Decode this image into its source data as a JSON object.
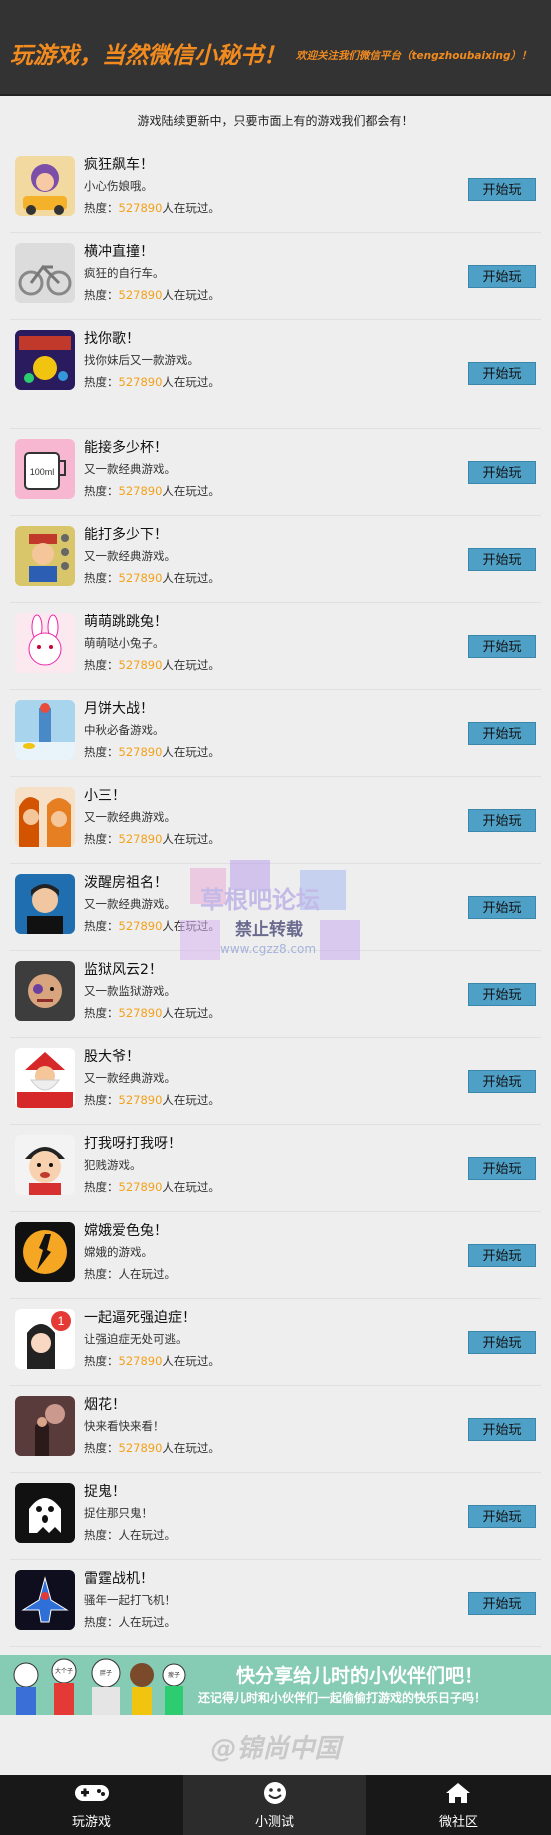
{
  "header": {
    "title": "玩游戏，当然微信小秘书！",
    "subtitle": "欢迎关注我们微信平台（tengzhoubaixing）！"
  },
  "notice": "游戏陆续更新中，只要市面上有的游戏我们都会有！",
  "games": [
    {
      "name": "疯狂飙车！",
      "desc": "小心伤娘哦。",
      "heat_prefix": "热度：",
      "heat": "527890",
      "heat_suffix": "人在玩过。",
      "button": "开始玩",
      "icon": "racing-car-icon"
    },
    {
      "name": "横冲直撞！",
      "desc": "疯狂的自行车。",
      "heat_prefix": "热度：",
      "heat": "527890",
      "heat_suffix": "人在玩过。",
      "button": "开始玩",
      "icon": "bicycle-icon"
    },
    {
      "name": "找你歌！",
      "desc": "找你妹后又一款游戏。",
      "heat_prefix": "热度：",
      "heat": "527890",
      "heat_suffix": "人在玩过。",
      "button": "开始玩",
      "icon": "find-game-icon"
    },
    {
      "name": "能接多少杯！",
      "desc": "又一款经典游戏。",
      "heat_prefix": "热度：",
      "heat": "527890",
      "heat_suffix": "人在玩过。",
      "button": "开始玩",
      "icon": "cup-100ml-icon"
    },
    {
      "name": "能打多少下！",
      "desc": "又一款经典游戏。",
      "heat_prefix": "热度：",
      "heat": "527890",
      "heat_suffix": "人在玩过。",
      "button": "开始玩",
      "icon": "mario-icon"
    },
    {
      "name": "萌萌跳跳兔！",
      "desc": "萌萌哒小兔子。",
      "heat_prefix": "热度：",
      "heat": "527890",
      "heat_suffix": "人在玩过。",
      "button": "开始玩",
      "icon": "rabbit-icon"
    },
    {
      "name": "月饼大战！",
      "desc": "中秋必备游戏。",
      "heat_prefix": "热度：",
      "heat": "527890",
      "heat_suffix": "人在玩过。",
      "button": "开始玩",
      "icon": "mooncake-icon"
    },
    {
      "name": "小三！",
      "desc": "又一款经典游戏。",
      "heat_prefix": "热度：",
      "heat": "527890",
      "heat_suffix": "人在玩过。",
      "button": "开始玩",
      "icon": "women-icon"
    },
    {
      "name": "泼醒房祖名！",
      "desc": "又一款经典游戏。",
      "heat_prefix": "热度：",
      "heat": "527890",
      "heat_suffix": "人在玩过。",
      "button": "开始玩",
      "icon": "man-portrait-icon"
    },
    {
      "name": "监狱风云2！",
      "desc": "又一款监狱游戏。",
      "heat_prefix": "热度：",
      "heat": "527890",
      "heat_suffix": "人在玩过。",
      "button": "开始玩",
      "icon": "prisoner-icon"
    },
    {
      "name": "股大爷！",
      "desc": "又一款经典游戏。",
      "heat_prefix": "热度：",
      "heat": "527890",
      "heat_suffix": "人在玩过。",
      "button": "开始玩",
      "icon": "santa-icon"
    },
    {
      "name": "打我呀打我呀！",
      "desc": "犯贱游戏。",
      "heat_prefix": "热度：",
      "heat": "527890",
      "heat_suffix": "人在玩过。",
      "button": "开始玩",
      "icon": "cartoon-boy-icon"
    },
    {
      "name": "嫦娥爱色兔！",
      "desc": "嫦娥的游戏。",
      "heat_prefix": "热度：",
      "heat": "",
      "heat_suffix": "人在玩过。",
      "button": "开始玩",
      "icon": "moon-rabbit-icon"
    },
    {
      "name": "一起逼死强迫症！",
      "desc": "让强迫症无处可逃。",
      "heat_prefix": "热度：",
      "heat": "527890",
      "heat_suffix": "人在玩过。",
      "button": "开始玩",
      "icon": "notification-girl-icon"
    },
    {
      "name": "烟花！",
      "desc": "快来看快来看！",
      "heat_prefix": "热度：",
      "heat": "527890",
      "heat_suffix": "人在玩过。",
      "button": "开始玩",
      "icon": "fireworks-icon"
    },
    {
      "name": "捉鬼！",
      "desc": "捉住那只鬼！",
      "heat_prefix": "热度：",
      "heat": "",
      "heat_suffix": "人在玩过。",
      "button": "开始玩",
      "icon": "ghost-icon"
    },
    {
      "name": "雷霆战机！",
      "desc": "骚年一起打飞机！",
      "heat_prefix": "热度：",
      "heat": "",
      "heat_suffix": "人在玩过。",
      "button": "开始玩",
      "icon": "fighter-jet-icon"
    }
  ],
  "banner": {
    "title": "快分享给儿时的小伙伴们吧！",
    "subtitle": "还记得儿时和小伙伴们一起偷偷打游戏的快乐日子吗！",
    "kid_labels": [
      "大个子",
      "胖子",
      "瘦子"
    ]
  },
  "signature": "@锦尚中国",
  "watermark": {
    "line1": "草根吧论坛",
    "line2": "禁止转载",
    "line3": "www.cgzz8.com"
  },
  "tabs": [
    {
      "label": "玩游戏",
      "icon": "gamepad-icon"
    },
    {
      "label": "小测试",
      "icon": "smiley-icon"
    },
    {
      "label": "微社区",
      "icon": "home-icon"
    }
  ],
  "colors": {
    "header_bg": "#333333",
    "header_text": "#f28b1f",
    "button_bg": "#4ea0c7",
    "heat_number": "#f4a11a",
    "banner_bg": "#86cbb3",
    "tabbar_bg": "#181818"
  }
}
